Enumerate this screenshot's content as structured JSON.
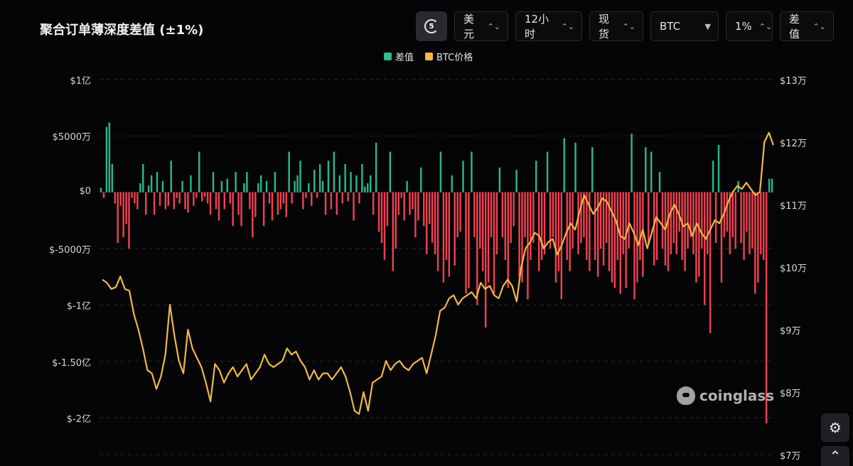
{
  "title": "聚合订单薄深度差值 (±1%)",
  "toolbar": {
    "refresh_label": "5",
    "currency": "美元",
    "interval": "12小时",
    "market": "现货",
    "coin": "BTC",
    "range": "1%",
    "metric": "差值"
  },
  "legend": [
    {
      "label": "差值",
      "color": "#2fbf87"
    },
    {
      "label": "BTC价格",
      "color": "#f0b945"
    }
  ],
  "watermark": "coinglass",
  "colors": {
    "positive": "#2bb58a",
    "negative": "#f0404f",
    "price": "#f0b945",
    "grid": "#2a2a2e"
  },
  "chart_data": {
    "type": "bar",
    "left_axis": {
      "ticks": [
        {
          "value": 100000000,
          "label": "$1亿"
        },
        {
          "value": 50000000,
          "label": "$5000万"
        },
        {
          "value": 0,
          "label": "$0"
        },
        {
          "value": -50000000,
          "label": "$-5000万"
        },
        {
          "value": -100000000,
          "label": "$-1亿"
        },
        {
          "value": -150000000,
          "label": "$-1.50亿"
        },
        {
          "value": -200000000,
          "label": "$-2亿"
        }
      ],
      "ylim": [
        -200000000,
        100000000
      ]
    },
    "right_axis": {
      "ticks": [
        {
          "value": 130000,
          "label": "$13万"
        },
        {
          "value": 120000,
          "label": "$12万"
        },
        {
          "value": 110000,
          "label": "$11万"
        },
        {
          "value": 100000,
          "label": "$10万"
        },
        {
          "value": 90000,
          "label": "$9万"
        },
        {
          "value": 80000,
          "label": "$8万"
        },
        {
          "value": 70000,
          "label": "$7万"
        }
      ],
      "ylim": [
        70000,
        130000
      ]
    },
    "grid": true,
    "legend_position": "top-center",
    "series": [
      {
        "name": "差值",
        "kind": "bar",
        "values": [
          4,
          -5,
          58,
          62,
          25,
          -10,
          -45,
          -12,
          -40,
          -28,
          -50,
          -5,
          -10,
          -15,
          8,
          25,
          -20,
          6,
          15,
          -20,
          18,
          -12,
          10,
          -15,
          -12,
          28,
          -15,
          -5,
          -10,
          10,
          -15,
          -18,
          15,
          -12,
          -5,
          36,
          -8,
          -4,
          -10,
          -20,
          18,
          -15,
          -25,
          10,
          -15,
          12,
          -10,
          -30,
          18,
          -20,
          -30,
          8,
          18,
          -15,
          -40,
          -22,
          8,
          15,
          -30,
          10,
          -10,
          -25,
          18,
          -20,
          -15,
          -10,
          -22,
          36,
          -10,
          10,
          15,
          28,
          -15,
          -5,
          8,
          -12,
          20,
          -5,
          25,
          10,
          -20,
          28,
          -15,
          36,
          -20,
          15,
          -10,
          25,
          -8,
          18,
          -25,
          15,
          -10,
          25,
          5,
          8,
          15,
          -20,
          44,
          -35,
          -45,
          -60,
          -30,
          36,
          -70,
          -50,
          -20,
          -5,
          -25,
          10,
          -20,
          -15,
          -40,
          -25,
          22,
          -30,
          -55,
          -28,
          -45,
          -55,
          -70,
          36,
          -80,
          -60,
          -75,
          15,
          -65,
          -40,
          -35,
          28,
          -90,
          -85,
          36,
          -40,
          -100,
          -50,
          -70,
          -120,
          -80,
          -40,
          -90,
          -55,
          22,
          -40,
          -60,
          -85,
          -45,
          -30,
          20,
          -75,
          -80,
          -40,
          -95,
          -60,
          -45,
          28,
          -70,
          -60,
          -55,
          36,
          -50,
          -40,
          -80,
          -70,
          -95,
          48,
          -60,
          -70,
          -50,
          44,
          -55,
          -45,
          -40,
          -60,
          -70,
          40,
          -60,
          -75,
          -50,
          -65,
          -45,
          -70,
          -80,
          -85,
          -60,
          -90,
          -55,
          -85,
          -50,
          52,
          -95,
          -80,
          -60,
          -75,
          40,
          -45,
          36,
          -65,
          -60,
          18,
          -50,
          -65,
          -70,
          -55,
          -45,
          -55,
          -35,
          -60,
          -70,
          -50,
          -40,
          -55,
          -80,
          -75,
          -50,
          -100,
          -55,
          -125,
          28,
          -45,
          42,
          -80,
          -40,
          -35,
          -55,
          -40,
          -50,
          10,
          -45,
          -60,
          -35,
          -55,
          -50,
          -90,
          -80,
          -55,
          -60,
          -205,
          12,
          12
        ]
      },
      {
        "name": "BTC价格",
        "kind": "line",
        "values": [
          98000,
          97500,
          96500,
          96800,
          98500,
          96500,
          96200,
          92500,
          90000,
          87000,
          83500,
          83000,
          80500,
          82500,
          86000,
          94000,
          89000,
          85000,
          83000,
          90000,
          87000,
          85500,
          84000,
          81500,
          78500,
          84500,
          83500,
          81500,
          83000,
          84000,
          82500,
          83500,
          84500,
          82000,
          83000,
          84000,
          86000,
          84500,
          84000,
          84500,
          85000,
          87000,
          86000,
          86500,
          85000,
          84000,
          82000,
          83500,
          82000,
          83000,
          83000,
          82000,
          83000,
          84000,
          82500,
          80000,
          77000,
          76500,
          80000,
          77000,
          81500,
          82000,
          82500,
          85000,
          83500,
          84500,
          85000,
          84000,
          83500,
          84500,
          85000,
          85500,
          83000,
          86000,
          89000,
          93000,
          93500,
          95000,
          95500,
          94000,
          95000,
          95500,
          96000,
          95000,
          97500,
          96500,
          97000,
          95500,
          95000,
          97000,
          98000,
          97000,
          94500,
          100000,
          103000,
          104000,
          105500,
          105000,
          103000,
          104000,
          104500,
          102000,
          103500,
          105500,
          107000,
          106000,
          109000,
          111500,
          110000,
          108500,
          109500,
          111000,
          110500,
          109000,
          107500,
          105000,
          104500,
          107000,
          105500,
          103500,
          106000,
          103000,
          105500,
          108000,
          107000,
          106000,
          108500,
          110000,
          108500,
          106500,
          107000,
          105000,
          107000,
          105500,
          104500,
          106000,
          107500,
          107000,
          108500,
          110500,
          112000,
          113000,
          112500,
          113500,
          112500,
          111500,
          112000,
          120000,
          121500,
          119500
        ]
      }
    ]
  }
}
